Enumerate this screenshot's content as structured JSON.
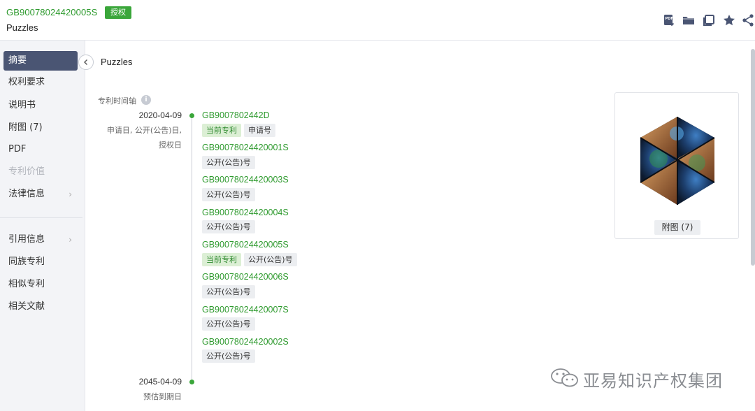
{
  "header": {
    "patent_number": "GB90078024420005S",
    "status_badge": "授权",
    "title": "Puzzles",
    "toolbar_icons": [
      "pdf-download-icon",
      "folder-icon",
      "copy-icon",
      "star-icon",
      "share-icon"
    ]
  },
  "sidebar": {
    "items": [
      {
        "label": "摘要",
        "state": "active"
      },
      {
        "label": "权利要求",
        "state": "normal"
      },
      {
        "label": "说明书",
        "state": "normal"
      },
      {
        "label": "附图 (7)",
        "state": "normal"
      },
      {
        "label": "PDF",
        "state": "normal"
      },
      {
        "label": "专利价值",
        "state": "disabled"
      },
      {
        "label": "法律信息",
        "state": "normal",
        "chevron": "›"
      },
      {
        "label": "引用信息",
        "state": "normal",
        "chevron": "›"
      },
      {
        "label": "同族专利",
        "state": "normal"
      },
      {
        "label": "相似专利",
        "state": "normal"
      },
      {
        "label": "相关文献",
        "state": "normal"
      }
    ]
  },
  "main": {
    "title": "Puzzles",
    "timeline_label": "专利时间轴",
    "info_glyph": "i",
    "start": {
      "date": "2020-04-09",
      "desc_line1": "申请日, 公开(公告)日,",
      "desc_line2": "授权日"
    },
    "end": {
      "date": "2045-04-09",
      "desc": "预估到期日"
    },
    "entries": [
      {
        "number": "GB9007802442D",
        "tags": [
          "当前专利",
          "申请号"
        ]
      },
      {
        "number": "GB90078024420001S",
        "tags": [
          "公开(公告)号"
        ]
      },
      {
        "number": "GB90078024420003S",
        "tags": [
          "公开(公告)号"
        ]
      },
      {
        "number": "GB90078024420004S",
        "tags": [
          "公开(公告)号"
        ]
      },
      {
        "number": "GB90078024420005S",
        "tags": [
          "当前专利",
          "公开(公告)号"
        ]
      },
      {
        "number": "GB90078024420006S",
        "tags": [
          "公开(公告)号"
        ]
      },
      {
        "number": "GB90078024420007S",
        "tags": [
          "公开(公告)号"
        ]
      },
      {
        "number": "GB90078024420002S",
        "tags": [
          "公开(公告)号"
        ]
      }
    ]
  },
  "figure": {
    "button_label": "附图 (7)"
  },
  "watermark": {
    "text": "亚易知识产权集团"
  },
  "colors": {
    "accent_green": "#3aa63a",
    "link_green": "#2e9a2e",
    "sidebar_active": "#4a5573"
  }
}
